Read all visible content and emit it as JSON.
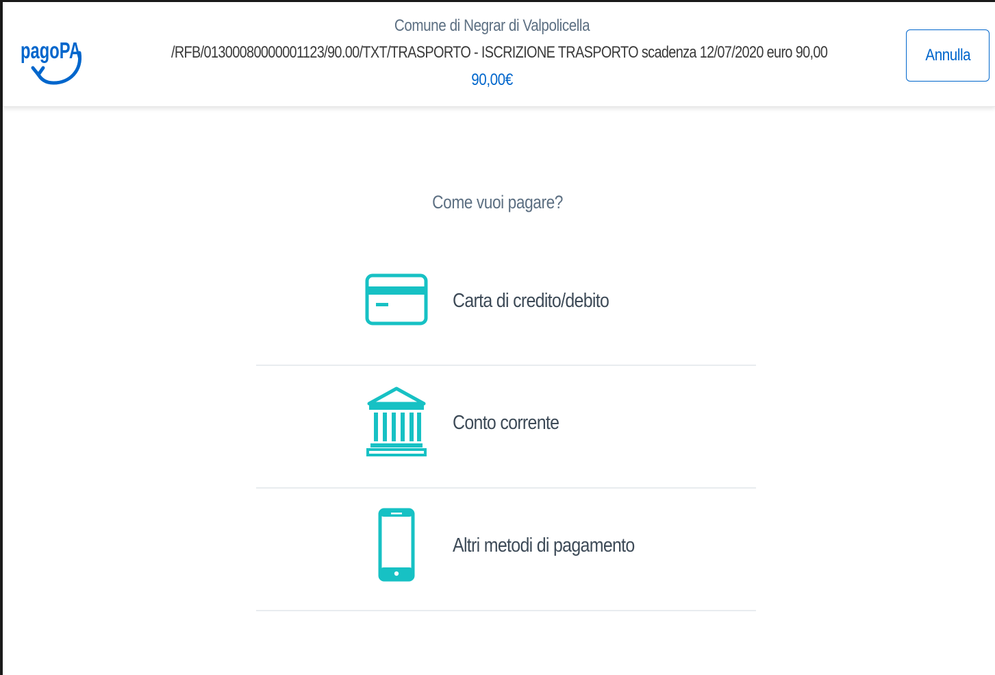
{
  "brand": {
    "name": "pagoPA",
    "color": "#0066cc"
  },
  "header": {
    "entity": "Comune di Negrar di Valpolicella",
    "causale": "/RFB/01300080000001123/90.00/TXT/TRASPORTO - ISCRIZIONE TRASPORTO scadenza 12/07/2020 euro 90,00",
    "amount": "90,00€",
    "cancel_label": "Annulla"
  },
  "main": {
    "question": "Come vuoi pagare?",
    "methods": [
      {
        "label": "Carta di credito/debito",
        "icon": "credit-card-icon"
      },
      {
        "label": "Conto corrente",
        "icon": "bank-icon"
      },
      {
        "label": "Altri metodi di pagamento",
        "icon": "smartphone-icon"
      }
    ]
  },
  "colors": {
    "accent": "#0066cc",
    "icon": "#17c1c4",
    "text_muted": "#5c6f82"
  }
}
